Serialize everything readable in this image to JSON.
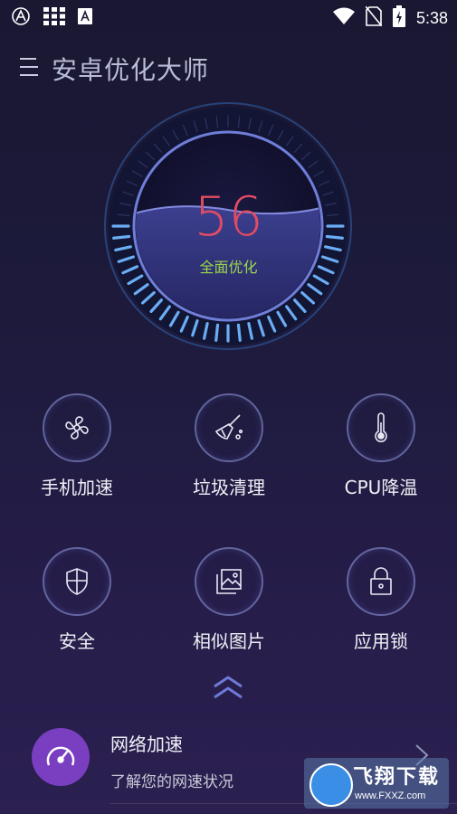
{
  "status_bar": {
    "time": "5:38",
    "left_icons": [
      "app-a-icon",
      "grid-icon",
      "store-icon"
    ],
    "right_icons": [
      "wifi-icon",
      "no-sim-icon",
      "battery-charging-icon"
    ]
  },
  "header": {
    "title": "安卓优化大师",
    "menu_icon": "hamburger-menu-icon"
  },
  "gauge": {
    "score": "56",
    "action_label": "全面优化",
    "score_color": "#e24b63",
    "label_color": "#9cd64a",
    "fill_level": 0.56
  },
  "features": [
    {
      "label": "手机加速",
      "icon": "fan-icon"
    },
    {
      "label": "垃圾清理",
      "icon": "broom-icon"
    },
    {
      "label": "CPU降温",
      "icon": "thermometer-icon"
    },
    {
      "label": "安全",
      "icon": "shield-icon"
    },
    {
      "label": "相似图片",
      "icon": "gallery-icon"
    },
    {
      "label": "应用锁",
      "icon": "padlock-icon"
    }
  ],
  "expand_icon": "double-chevron-up-icon",
  "network": {
    "title": "网络加速",
    "subtitle": "了解您的网速状况",
    "icon": "speedometer-icon",
    "icon_color": "#7a3fc1"
  },
  "watermark": {
    "text": "飞翔下载",
    "url": "www.FXXZ.com"
  },
  "colors": {
    "accent_blue": "#5d6ad6",
    "background": "#1e1b3e"
  }
}
